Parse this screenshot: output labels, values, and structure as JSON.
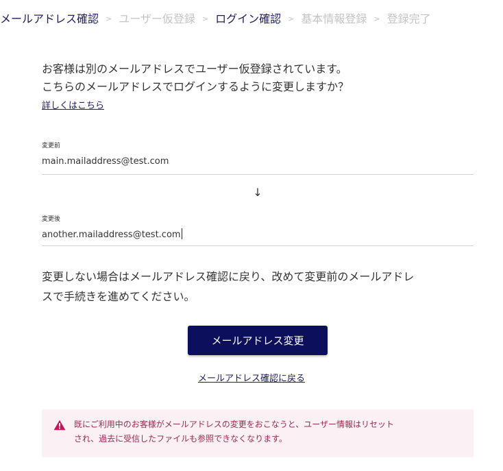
{
  "breadcrumb": {
    "separator": ">",
    "steps": [
      {
        "label": "メールアドレス確認",
        "state": "active"
      },
      {
        "label": "ユーザー仮登録",
        "state": "inactive"
      },
      {
        "label": "ログイン確認",
        "state": "active"
      },
      {
        "label": "基本情報登録",
        "state": "inactive"
      },
      {
        "label": "登録完了",
        "state": "inactive"
      }
    ]
  },
  "intro": {
    "line1": "お客様は別のメールアドレスでユーザー仮登録されています。",
    "line2": "こちらのメールアドレスでログインするように変更しますか？",
    "detail_link": "詳しくはこちら"
  },
  "email_change": {
    "before_label": "変更前",
    "before_value": "main.mailaddress@test.com",
    "arrow": "↓",
    "after_label": "変更後",
    "after_value": "another.mailaddress@test.com"
  },
  "note": {
    "line1": "変更しない場合はメールアドレス確認に戻り、改めて変更前のメールアドレ",
    "line2": "スで手続きを進めてください。"
  },
  "actions": {
    "change_button": "メールアドレス変更",
    "back_link": "メールアドレス確認に戻る"
  },
  "warning": {
    "icon": "warning-triangle-icon",
    "line1": "既にご利用中のお客様がメールアドレスの変更をおこなうと、ユーザー情報はリセット",
    "line2": "され、過去に受信したファイルも参照できなくなります。"
  },
  "colors": {
    "primary": "#0b0f5c",
    "active_step": "#1d1d5e",
    "inactive_step": "#c4c4c8",
    "warning_text": "#9b2a52",
    "warning_bg": "#fbf0f3"
  }
}
